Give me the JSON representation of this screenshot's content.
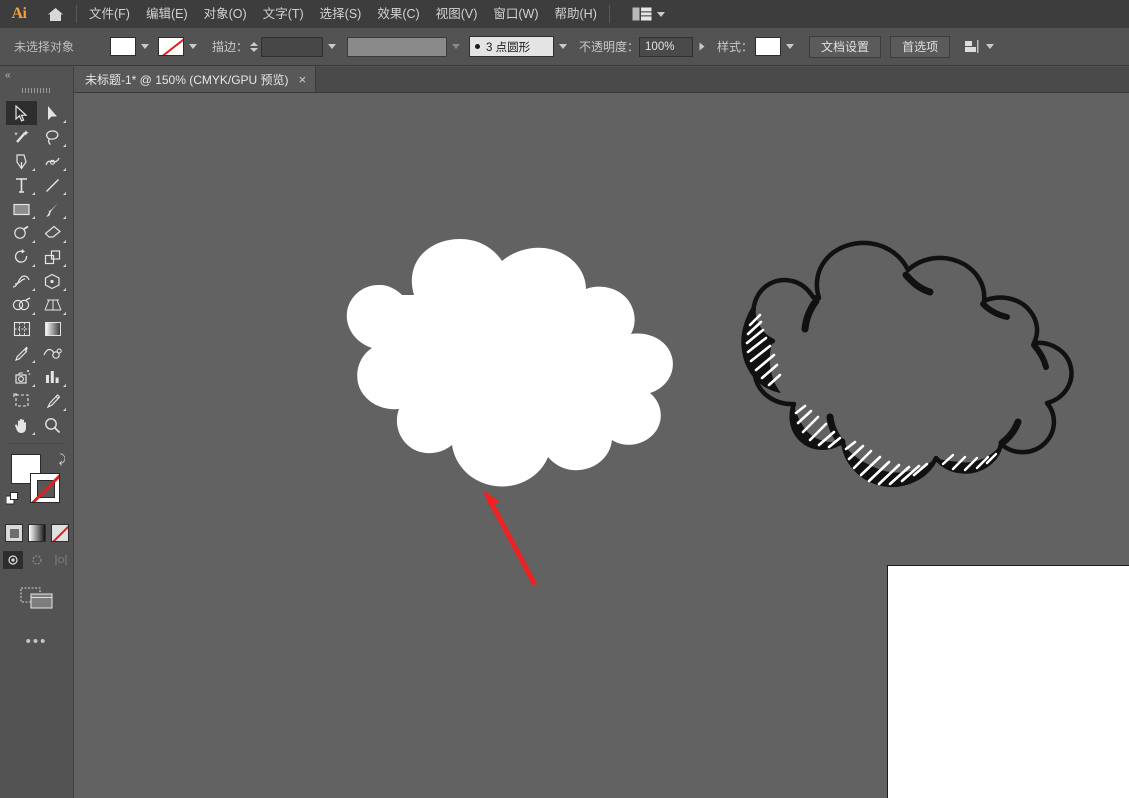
{
  "app": {
    "name": "Adobe Illustrator",
    "logo_text": "Ai",
    "home_icon": "home-icon",
    "workspace_icon": "workspace-switcher-icon",
    "workspace_caret": "chevron-down-icon"
  },
  "menubar": {
    "items": [
      {
        "label": "文件(F)"
      },
      {
        "label": "编辑(E)"
      },
      {
        "label": "对象(O)"
      },
      {
        "label": "文字(T)"
      },
      {
        "label": "选择(S)"
      },
      {
        "label": "效果(C)"
      },
      {
        "label": "视图(V)"
      },
      {
        "label": "窗口(W)"
      },
      {
        "label": "帮助(H)"
      }
    ]
  },
  "controlbar": {
    "status": "未选择对象",
    "fill_label": "fill-swatch",
    "fill_color": "#ffffff",
    "stroke_label": "stroke-swatch",
    "stroke_color": "none",
    "stroke_text": "描边：",
    "stroke_weight_value": "",
    "width_profile_value": "",
    "brush_value": "3 点圆形",
    "opacity_label": "不透明度：",
    "opacity_value": "100%",
    "style_label": "样式：",
    "style_color": "#ffffff",
    "doc_setup_btn": "文档设置",
    "prefs_btn": "首选项",
    "align_icon": "align-objects-icon"
  },
  "tabbar": {
    "tabs": [
      {
        "title": "未标题-1* @ 150% (CMYK/GPU 预览)",
        "close": "×"
      }
    ]
  },
  "toolbar": {
    "collapse_icon": "collapse-panel-icon",
    "collapse_glyph": "«",
    "grip": "drag-handle-grip",
    "tools": [
      {
        "name": "selection-tool",
        "active": true
      },
      {
        "name": "direct-selection-tool",
        "active": false
      },
      {
        "name": "magic-wand-tool",
        "active": false
      },
      {
        "name": "lasso-tool",
        "active": false
      },
      {
        "name": "pen-tool",
        "active": false
      },
      {
        "name": "curvature-tool",
        "active": false
      },
      {
        "name": "type-tool",
        "active": false
      },
      {
        "name": "line-segment-tool",
        "active": false
      },
      {
        "name": "rectangle-tool",
        "active": false
      },
      {
        "name": "paintbrush-tool",
        "active": false
      },
      {
        "name": "shaper-tool",
        "active": false
      },
      {
        "name": "eraser-tool",
        "active": false
      },
      {
        "name": "rotate-tool",
        "active": false
      },
      {
        "name": "scale-tool",
        "active": false
      },
      {
        "name": "width-tool",
        "active": false
      },
      {
        "name": "free-transform-tool",
        "active": false
      },
      {
        "name": "shape-builder-tool",
        "active": false
      },
      {
        "name": "perspective-grid-tool",
        "active": false
      },
      {
        "name": "mesh-tool",
        "active": false
      },
      {
        "name": "gradient-tool",
        "active": false
      },
      {
        "name": "eyedropper-tool",
        "active": false
      },
      {
        "name": "blend-tool",
        "active": false
      },
      {
        "name": "symbol-sprayer-tool",
        "active": false
      },
      {
        "name": "column-graph-tool",
        "active": false
      },
      {
        "name": "artboard-tool",
        "active": false
      },
      {
        "name": "slice-tool",
        "active": false
      },
      {
        "name": "hand-tool",
        "active": false
      },
      {
        "name": "zoom-tool",
        "active": false
      }
    ],
    "fill_swatch": "#ffffff",
    "stroke_swatch": "none",
    "swap_icon": "swap-fill-stroke-icon",
    "default_icon": "default-fill-stroke-icon",
    "mode_buttons": [
      {
        "name": "color-mode-button"
      },
      {
        "name": "gradient-mode-button"
      },
      {
        "name": "none-mode-button"
      }
    ],
    "draw_modes": [
      {
        "name": "draw-normal-button",
        "active": true
      },
      {
        "name": "draw-behind-button",
        "active": false
      },
      {
        "name": "draw-inside-button",
        "active": false
      }
    ],
    "screen_mode_icon": "change-screen-mode-icon",
    "more_icon": "edit-toolbar-icon",
    "more_glyph": "•••"
  },
  "canvas": {
    "background_color": "#626262",
    "artwork": [
      {
        "name": "cloud-filled-white",
        "style": "solid white fill, no stroke"
      },
      {
        "name": "cloud-outline-sketch",
        "style": "black outline with hatched shading"
      }
    ],
    "annotation": {
      "name": "red-arrow-annotation",
      "color": "#ee2222"
    },
    "artboard": {
      "name": "artboard-1",
      "fill": "#ffffff"
    }
  }
}
